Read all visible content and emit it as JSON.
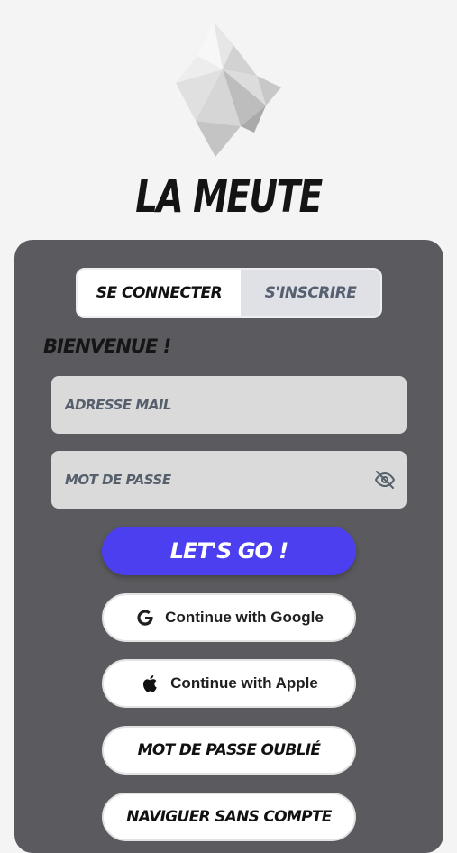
{
  "app": {
    "title": "LA MEUTE",
    "logo_icon": "wolf-head-icon"
  },
  "tabs": [
    {
      "label": "SE CONNECTER",
      "active": true
    },
    {
      "label": "S'INSCRIRE",
      "active": false
    }
  ],
  "form": {
    "welcome": "BIENVENUE !",
    "email_placeholder": "ADRESSE MAIL",
    "password_placeholder": "MOT DE PASSE",
    "password_toggle_icon": "eye-off-icon"
  },
  "buttons": {
    "submit": "LET'S GO !",
    "google": "Continue with Google",
    "apple": "Continue with Apple",
    "forgot": "MOT DE PASSE OUBLIÉ",
    "guest": "NAVIGUER SANS COMPTE"
  },
  "colors": {
    "background": "#f4f4f4",
    "panel": "#5b5b5f",
    "accent": "#4b3ff0",
    "field": "#dadada"
  }
}
